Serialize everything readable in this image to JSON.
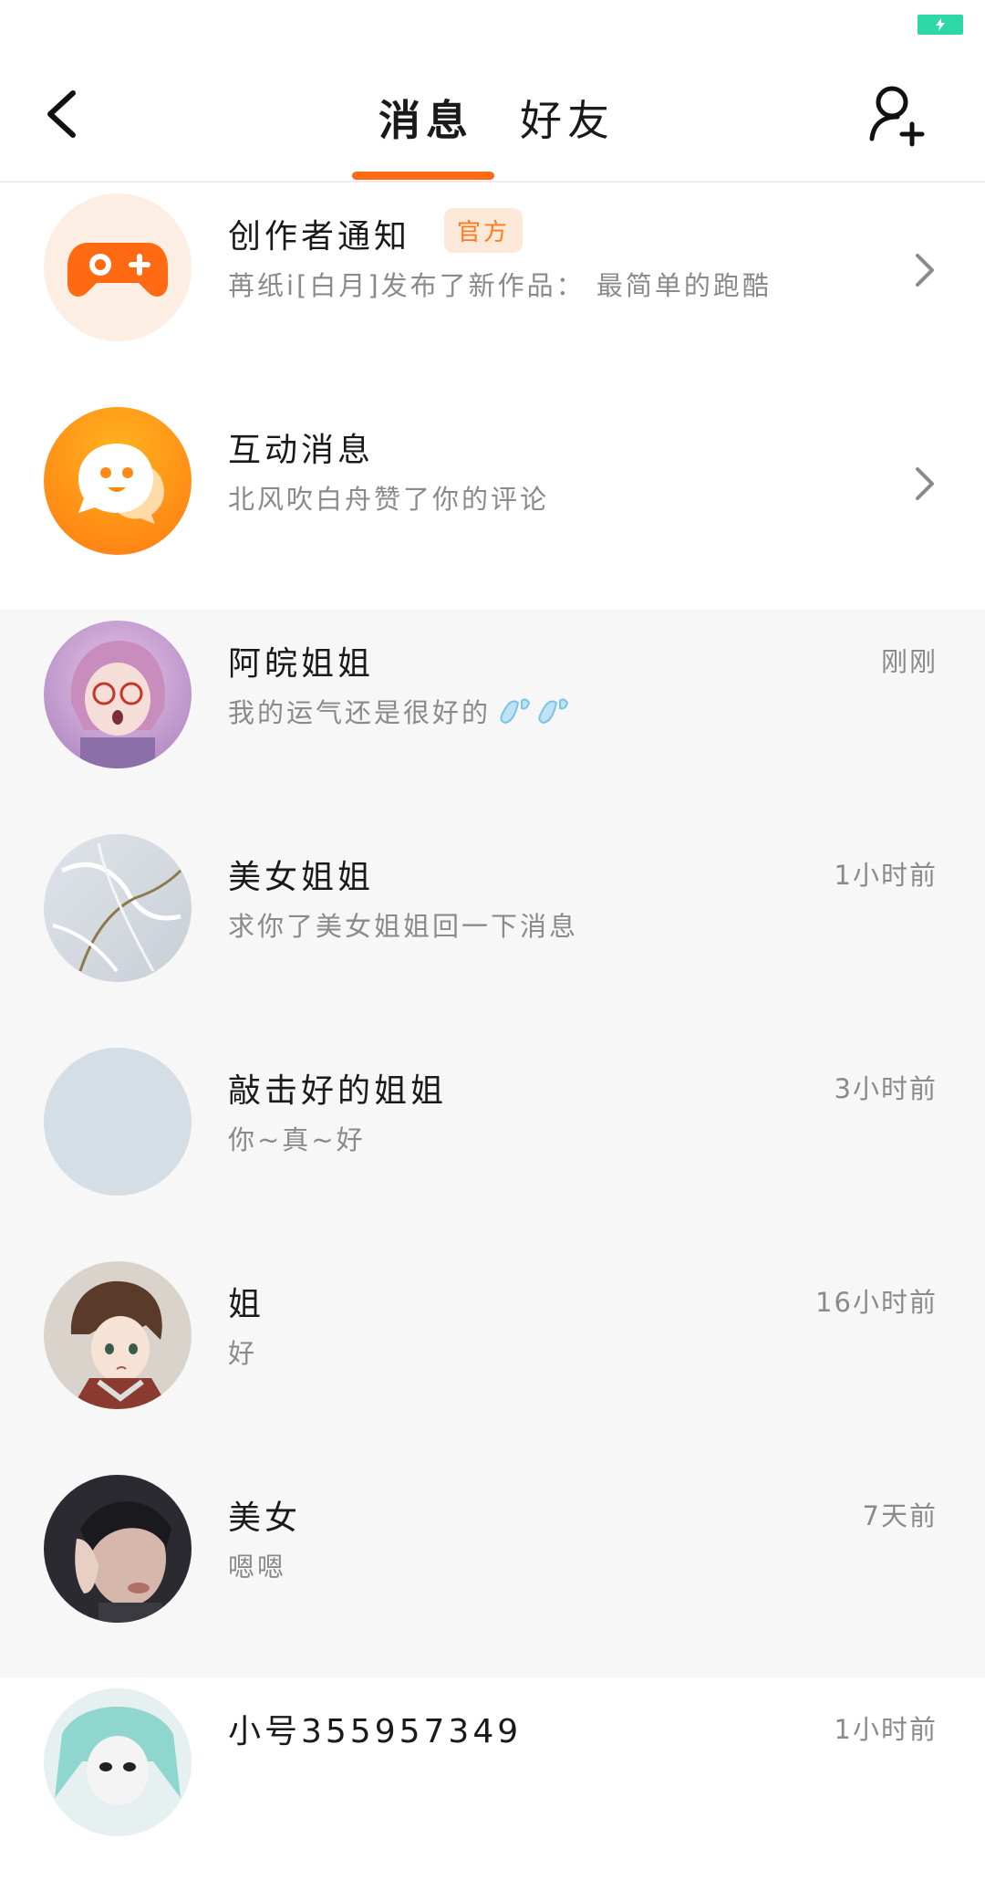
{
  "header": {
    "tabs": [
      {
        "label": "消息",
        "active": true
      },
      {
        "label": "好友",
        "active": false
      }
    ]
  },
  "icons": {
    "back": "chevron-left-icon",
    "add_friend": "add-user-icon",
    "battery": "battery-charging-icon"
  },
  "colors": {
    "accent": "#ff6a13",
    "battery": "#2ed8a4",
    "badge_text": "#ff7a1e",
    "badge_bg": "#fde9d9"
  },
  "system_items": [
    {
      "title": "创作者通知",
      "badge": "官方",
      "subtitle": "苒纸i[白月]发布了新作品： 最简单的跑酷",
      "icon": "gamepad-icon"
    },
    {
      "title": "互动消息",
      "subtitle": "北风吹白舟赞了你的评论",
      "icon": "chat-bubble-smile-icon"
    }
  ],
  "conversations": [
    {
      "name": "阿皖姐姐",
      "message": "我的运气还是很好的",
      "time": "刚刚",
      "emoji": "sweat-droplets-icon"
    },
    {
      "name": "美女姐姐",
      "message": "求你了美女姐姐回一下消息",
      "time": "1小时前"
    },
    {
      "name": "敲击好的姐姐",
      "message": "你~真~好",
      "time": "3小时前"
    },
    {
      "name": "姐",
      "message": "好",
      "time": "16小时前"
    },
    {
      "name": "美女",
      "message": "嗯嗯",
      "time": "7天前"
    },
    {
      "name": "小号355957349",
      "message": "",
      "time": "1小时前"
    }
  ]
}
